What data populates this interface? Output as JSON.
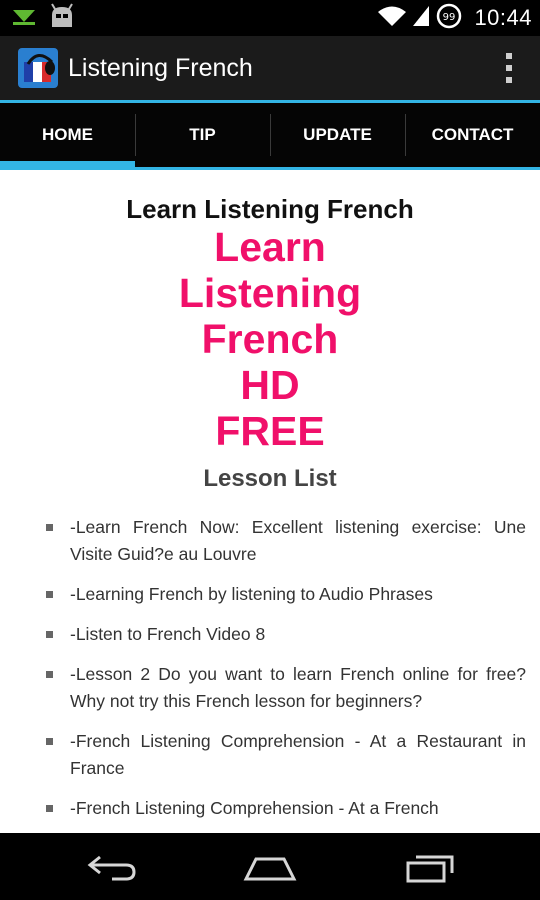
{
  "status_bar": {
    "time": "10:44",
    "notification_badge": "99",
    "icons": [
      "download-notification-icon",
      "android-robot-icon",
      "wifi-icon",
      "cell-signal-icon",
      "battery-icon"
    ]
  },
  "action_bar": {
    "title": "Listening French",
    "app_icon": "french-flag-headphones-icon",
    "menu_icon": "overflow-menu-icon"
  },
  "tabs": [
    {
      "label": "HOME",
      "active": true
    },
    {
      "label": "TIP",
      "active": false
    },
    {
      "label": "UPDATE",
      "active": false
    },
    {
      "label": "CONTACT",
      "active": false
    }
  ],
  "content": {
    "headline": "Learn Listening French",
    "big_title_lines": [
      "Learn",
      "Listening",
      "French",
      "HD",
      "FREE"
    ],
    "lesson_heading": "Lesson List",
    "lessons": [
      "-Learn French Now: Excellent listening exercise: Une Visite Guid?e au Louvre",
      "-Learning French by listening to Audio Phrases",
      "-Listen to French Video 8",
      "-Lesson 2 Do you want to learn French online for free? Why not try this French lesson for beginners?",
      "-French Listening Comprehension - At a Restaurant in France",
      "-French Listening Comprehension - At a French"
    ]
  },
  "colors": {
    "accent": "#33b5e5",
    "title_pink": "#f0106a",
    "action_bar": "#1b1b1b"
  },
  "nav_bar": {
    "icons": [
      "back-icon",
      "home-icon",
      "recent-apps-icon"
    ]
  }
}
